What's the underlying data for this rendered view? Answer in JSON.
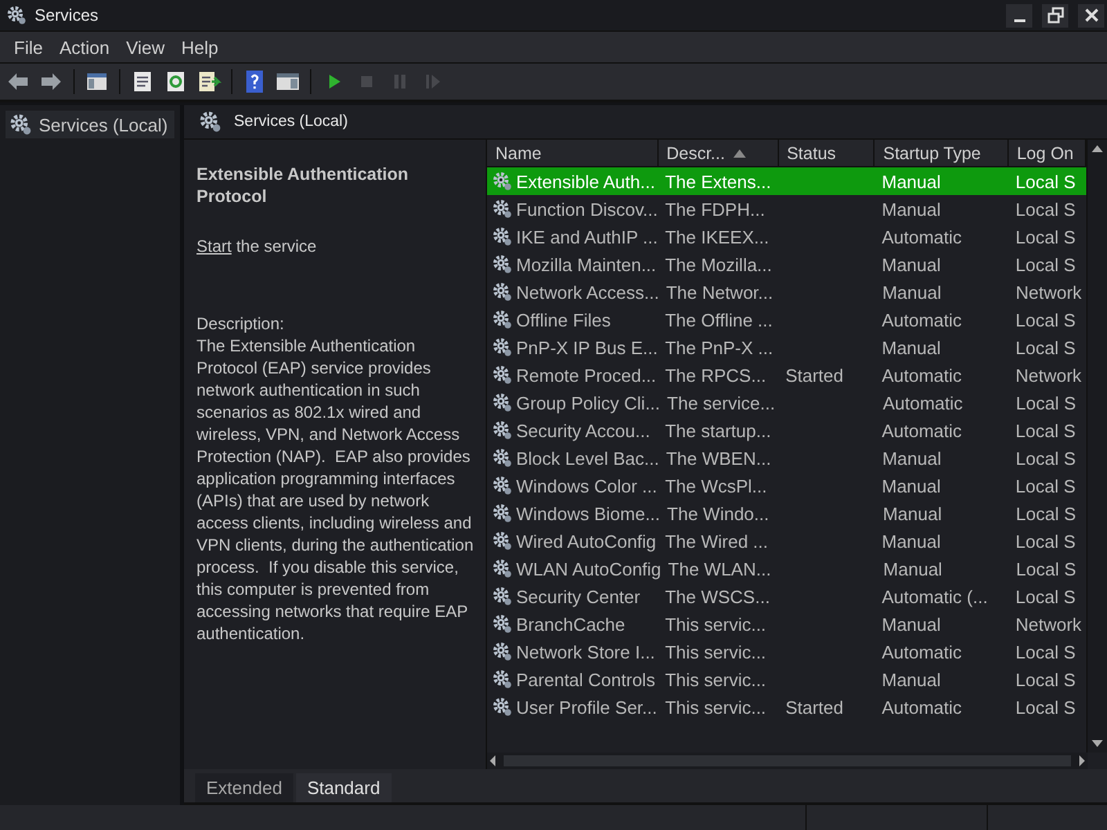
{
  "window": {
    "title": "Services"
  },
  "menu": [
    "File",
    "Action",
    "View",
    "Help"
  ],
  "toolbar": [
    {
      "kind": "back",
      "disabled": false
    },
    {
      "kind": "forward",
      "disabled": false
    },
    {
      "kind": "tree",
      "disabled": false
    },
    {
      "kind": "properties",
      "disabled": false
    },
    {
      "kind": "refresh",
      "disabled": false
    },
    {
      "kind": "export",
      "disabled": false
    },
    {
      "kind": "help",
      "disabled": false
    },
    {
      "kind": "pane",
      "disabled": false
    },
    {
      "kind": "start",
      "disabled": false
    },
    {
      "kind": "stop",
      "disabled": true
    },
    {
      "kind": "pause",
      "disabled": true
    },
    {
      "kind": "resume",
      "disabled": true
    }
  ],
  "tree": {
    "items": [
      {
        "label": "Services (Local)",
        "selected": true
      }
    ]
  },
  "pane_header": "Services (Local)",
  "details": {
    "title": "Extensible Authentication Protocol",
    "action_link": "Start",
    "action_text": "the service",
    "description_label": "Description:",
    "description": "The Extensible Authentication Protocol (EAP) service provides network authentication in such scenarios as 802.1x wired and wireless, VPN, and Network Access Protection (NAP).  EAP also provides application programming interfaces (APIs) that are used by network access clients, including wireless and VPN clients, during the authentication process.  If you disable this service, this computer is prevented from accessing networks that require EAP authentication."
  },
  "table": {
    "columns": [
      {
        "label": "Name",
        "sorted": false
      },
      {
        "label": "Descr...",
        "sorted": true
      },
      {
        "label": "Status",
        "sorted": false
      },
      {
        "label": "Startup Type",
        "sorted": false
      },
      {
        "label": "Log On",
        "sorted": false
      }
    ],
    "rows": [
      {
        "cells": [
          "Extensible Auth...",
          "The Extens...",
          "",
          "Manual",
          "Local S"
        ],
        "selected": true
      },
      {
        "cells": [
          "Function Discov...",
          "The FDPH...",
          "",
          "Manual",
          "Local S"
        ],
        "selected": false
      },
      {
        "cells": [
          "IKE and AuthIP ...",
          "The IKEEX...",
          "",
          "Automatic",
          "Local S"
        ],
        "selected": false
      },
      {
        "cells": [
          "Mozilla Mainten...",
          "The Mozilla...",
          "",
          "Manual",
          "Local S"
        ],
        "selected": false
      },
      {
        "cells": [
          "Network Access...",
          "The Networ...",
          "",
          "Manual",
          "Network"
        ],
        "selected": false
      },
      {
        "cells": [
          "Offline Files",
          "The Offline ...",
          "",
          "Automatic",
          "Local S"
        ],
        "selected": false
      },
      {
        "cells": [
          "PnP-X IP Bus E...",
          "The PnP-X ...",
          "",
          "Manual",
          "Local S"
        ],
        "selected": false
      },
      {
        "cells": [
          "Remote Proced...",
          "The RPCS...",
          "Started",
          "Automatic",
          "Network"
        ],
        "selected": false
      },
      {
        "cells": [
          "Group Policy Cli...",
          "The service...",
          "",
          "Automatic",
          "Local S"
        ],
        "selected": false
      },
      {
        "cells": [
          "Security Accou...",
          "The startup...",
          "",
          "Automatic",
          "Local S"
        ],
        "selected": false
      },
      {
        "cells": [
          "Block Level Bac...",
          "The WBEN...",
          "",
          "Manual",
          "Local S"
        ],
        "selected": false
      },
      {
        "cells": [
          "Windows Color ...",
          "The WcsPl...",
          "",
          "Manual",
          "Local S"
        ],
        "selected": false
      },
      {
        "cells": [
          "Windows Biome...",
          "The Windo...",
          "",
          "Manual",
          "Local S"
        ],
        "selected": false
      },
      {
        "cells": [
          "Wired AutoConfig",
          "The Wired ...",
          "",
          "Manual",
          "Local S"
        ],
        "selected": false
      },
      {
        "cells": [
          "WLAN AutoConfig",
          "The WLAN...",
          "",
          "Manual",
          "Local S"
        ],
        "selected": false
      },
      {
        "cells": [
          "Security Center",
          "The WSCS...",
          "",
          "Automatic (...",
          "Local S"
        ],
        "selected": false
      },
      {
        "cells": [
          "BranchCache",
          "This servic...",
          "",
          "Manual",
          "Network"
        ],
        "selected": false
      },
      {
        "cells": [
          "Network Store I...",
          "This servic...",
          "",
          "Automatic",
          "Local S"
        ],
        "selected": false
      },
      {
        "cells": [
          "Parental Controls",
          "This servic...",
          "",
          "Manual",
          "Local S"
        ],
        "selected": false
      },
      {
        "cells": [
          "User Profile Ser...",
          "This servic...",
          "Started",
          "Automatic",
          "Local S"
        ],
        "selected": false
      }
    ]
  },
  "view_tabs": [
    {
      "label": "Extended",
      "selected": false
    },
    {
      "label": "Standard",
      "selected": true
    }
  ]
}
